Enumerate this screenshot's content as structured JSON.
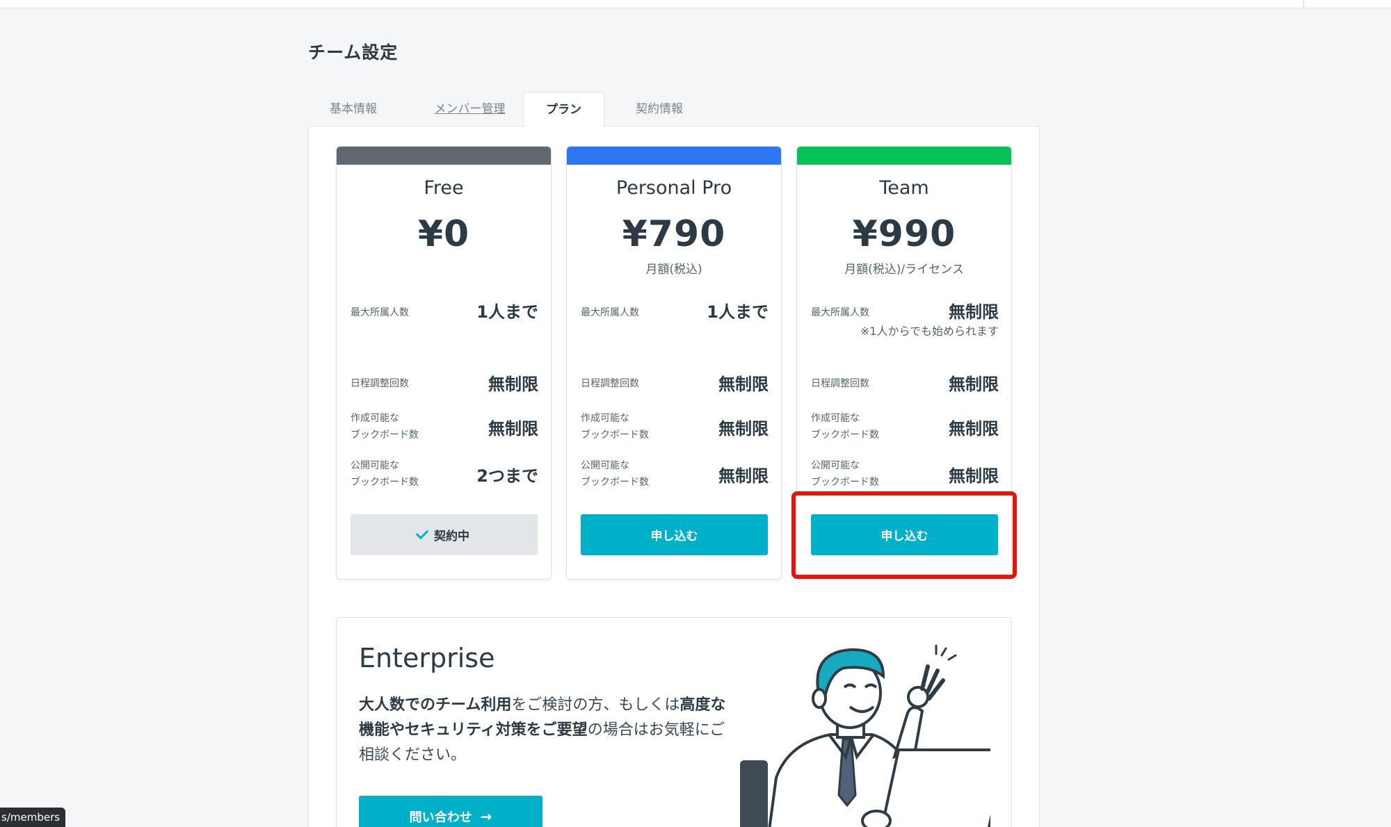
{
  "page": {
    "title": "チーム設定"
  },
  "tabs": [
    {
      "label": "基本情報"
    },
    {
      "label": "メンバー管理"
    },
    {
      "label": "プラン",
      "active": true
    },
    {
      "label": "契約情報"
    }
  ],
  "plans": [
    {
      "name": "Free",
      "price": "¥0",
      "price_note": "",
      "band_color": "#5f6970",
      "rows": {
        "members_label": "最大所属人数",
        "members_value": "1人まで",
        "members_note": "",
        "schedule_label": "日程調整回数",
        "schedule_value": "無制限",
        "create_label_1": "作成可能な",
        "create_label_2": "ブックボード数",
        "create_value": "無制限",
        "publish_label_1": "公開可能な",
        "publish_label_2": "ブックボード数",
        "publish_value": "2つまで"
      },
      "button": "契約中",
      "button_state": "current"
    },
    {
      "name": "Personal Pro",
      "price": "¥790",
      "price_note": "月額(税込)",
      "band_color": "#3076f2",
      "rows": {
        "members_label": "最大所属人数",
        "members_value": "1人まで",
        "members_note": "",
        "schedule_label": "日程調整回数",
        "schedule_value": "無制限",
        "create_label_1": "作成可能な",
        "create_label_2": "ブックボード数",
        "create_value": "無制限",
        "publish_label_1": "公開可能な",
        "publish_label_2": "ブックボード数",
        "publish_value": "無制限"
      },
      "button": "申し込む",
      "button_state": "primary"
    },
    {
      "name": "Team",
      "price": "¥990",
      "price_note": "月額(税込)/ライセンス",
      "band_color": "#05c158",
      "rows": {
        "members_label": "最大所属人数",
        "members_value": "無制限",
        "members_note": "※1人からでも始められます",
        "schedule_label": "日程調整回数",
        "schedule_value": "無制限",
        "create_label_1": "作成可能な",
        "create_label_2": "ブックボード数",
        "create_value": "無制限",
        "publish_label_1": "公開可能な",
        "publish_label_2": "ブックボード数",
        "publish_value": "無制限"
      },
      "button": "申し込む",
      "button_state": "primary"
    }
  ],
  "enterprise": {
    "title": "Enterprise",
    "desc_b1": "大人数でのチーム利用",
    "desc_t1": "をご検討の方、もしくは",
    "desc_b2": "高度な機能やセキュリティ対策をご要望",
    "desc_t2": "の場合はお気軽にご相談ください。",
    "contact_button": "問い合わせ",
    "contact_arrow": "→"
  },
  "statusbar": {
    "url_fragment": "s/members"
  },
  "colors": {
    "accent": "#00b0c8",
    "highlight": "#e3160e"
  }
}
